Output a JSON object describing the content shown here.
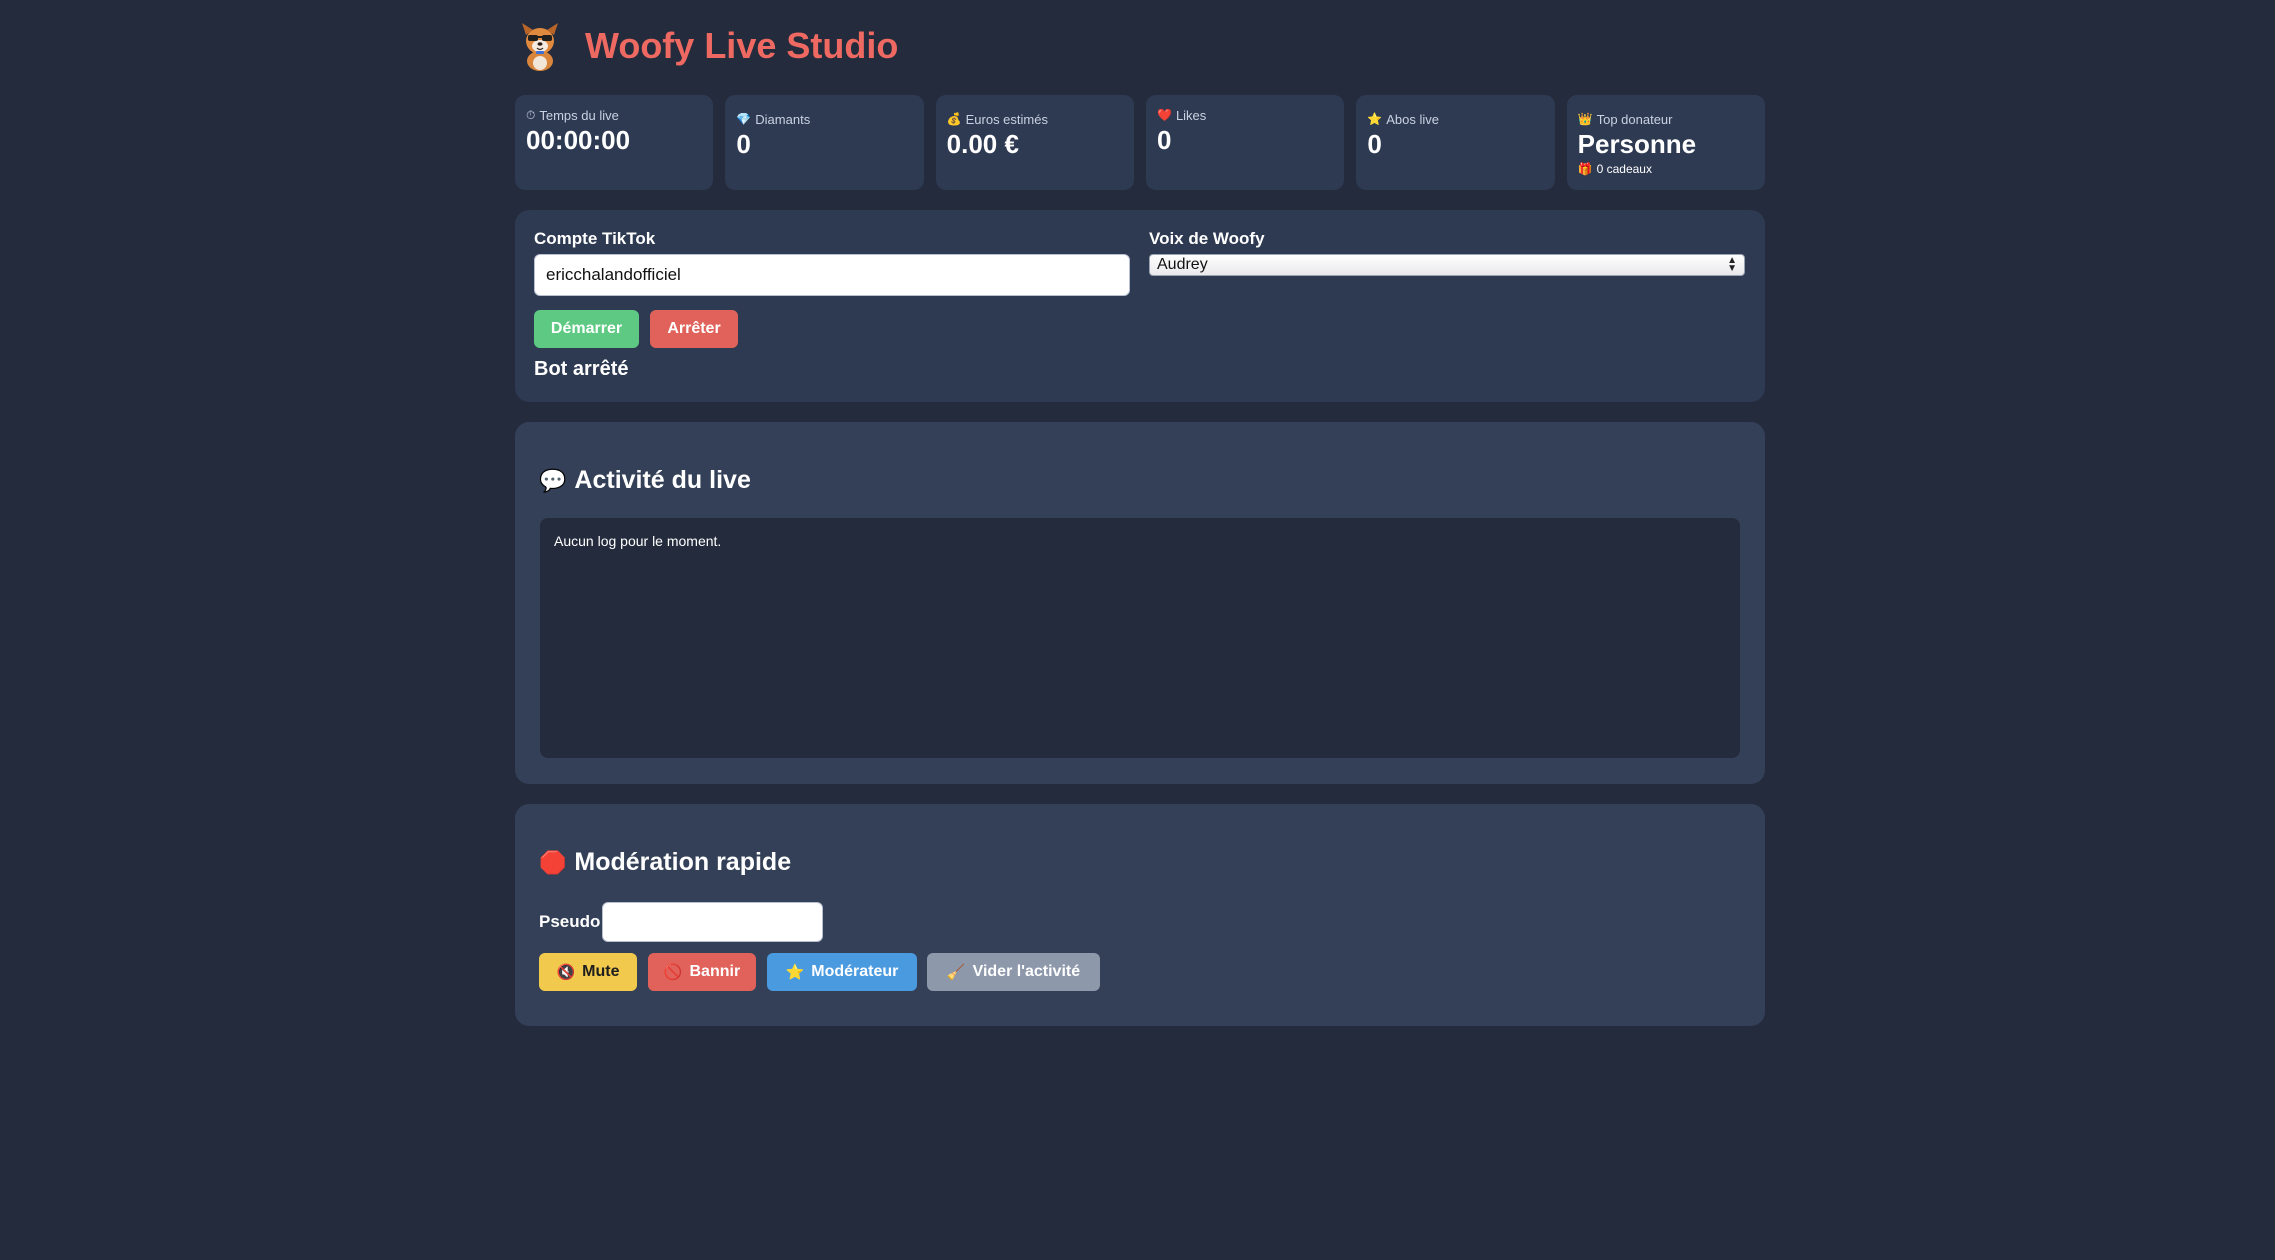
{
  "app": {
    "title": "Woofy Live Studio",
    "logo_icon": "dog-mascot-icon"
  },
  "stats": [
    {
      "icon": "stopwatch-icon",
      "glyph": "⏱",
      "label": "Temps du live",
      "value": "00:00:00"
    },
    {
      "icon": "diamond-icon",
      "glyph": "💎",
      "label": "Diamants",
      "value": "0"
    },
    {
      "icon": "money-bag-icon",
      "glyph": "💰",
      "label": "Euros estimés",
      "value": "0.00 €"
    },
    {
      "icon": "heart-icon",
      "glyph": "❤️",
      "label": "Likes",
      "value": "0"
    },
    {
      "icon": "star-icon",
      "glyph": "⭐",
      "label": "Abos live",
      "value": "0"
    },
    {
      "icon": "crown-icon",
      "glyph": "👑",
      "label": "Top donateur",
      "value": "Personne",
      "sub_glyph": "🎁",
      "sub_icon": "gift-icon",
      "sub": "0 cadeaux"
    }
  ],
  "config": {
    "account_label": "Compte TikTok",
    "account_value": "ericchalandofficiel",
    "voice_label": "Voix de Woofy",
    "voice_selected": "Audrey",
    "start_label": "Démarrer",
    "stop_label": "Arrêter",
    "status": "Bot arrêté"
  },
  "activity": {
    "icon": "speech-bubble-icon",
    "glyph": "💬",
    "title": "Activité du live",
    "log_text": "Aucun log pour le moment."
  },
  "moderation": {
    "icon": "stop-sign-icon",
    "glyph": "🛑",
    "title": "Modération rapide",
    "pseudo_label": "Pseudo",
    "pseudo_value": "",
    "buttons": [
      {
        "icon": "muted-speaker-icon",
        "glyph": "🔇",
        "label": "Mute"
      },
      {
        "icon": "no-entry-icon",
        "glyph": "🚫",
        "label": "Bannir"
      },
      {
        "icon": "star-icon",
        "glyph": "⭐",
        "label": "Modérateur"
      },
      {
        "icon": "broom-icon",
        "glyph": "🧹",
        "label": "Vider l'activité"
      }
    ]
  },
  "colors": {
    "background": "#232b3c",
    "panel": "#2e3a52",
    "title_accent": "#ee6961",
    "start": "#5dc982",
    "stop": "#e0625a",
    "mute": "#f0c94d",
    "ban": "#e0625a",
    "moderator": "#4a9ae0",
    "clear": "#8d98ab"
  }
}
